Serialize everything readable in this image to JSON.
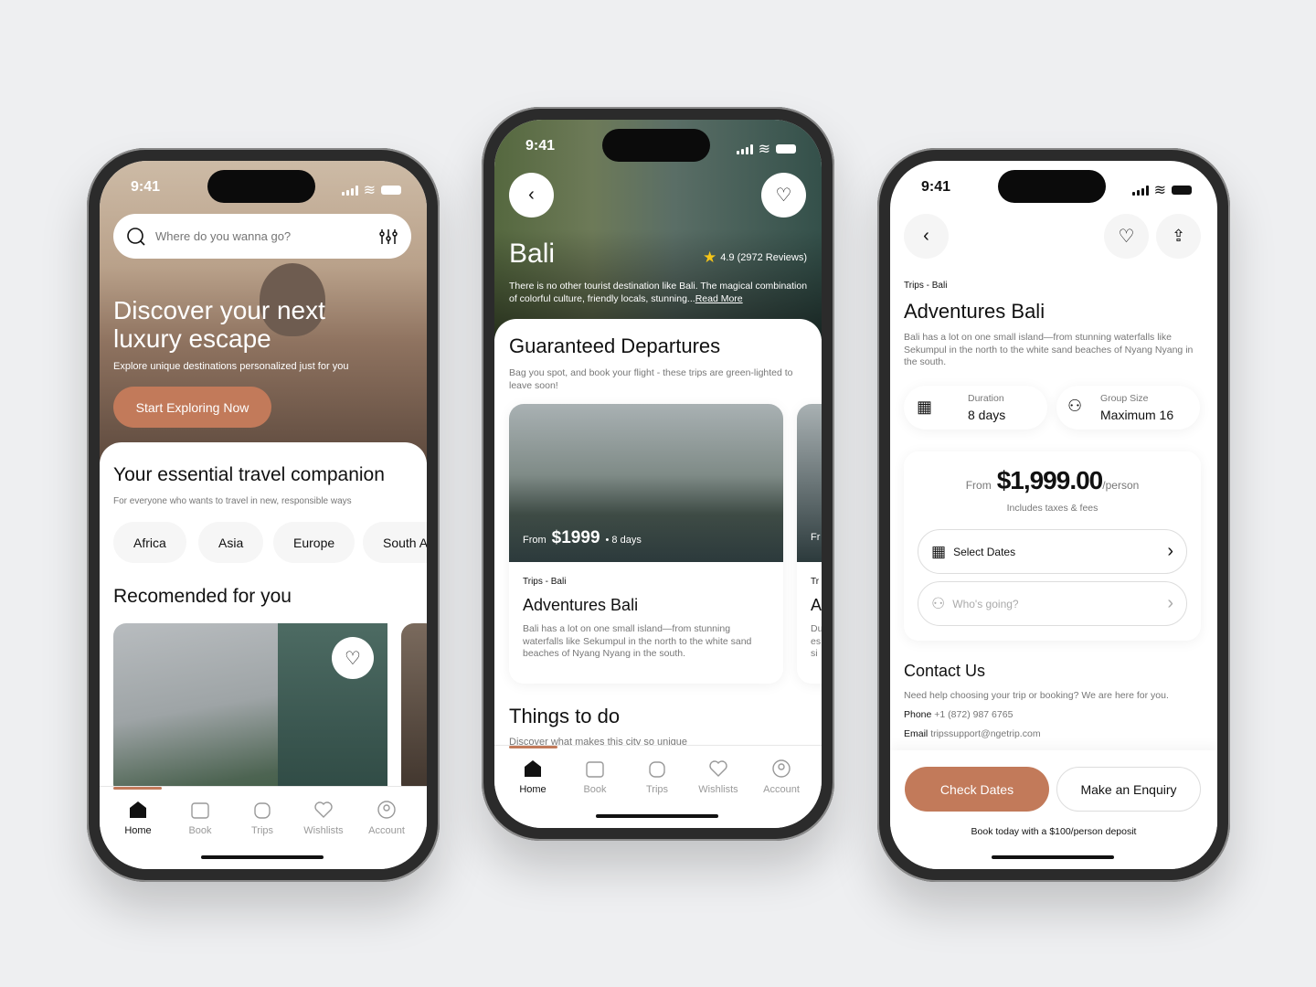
{
  "status_time": "9:41",
  "colors": {
    "accent": "#c27a5a",
    "background": "#eeeff1",
    "star": "#f5c518"
  },
  "tabs": [
    {
      "label": "Home",
      "icon": "home-icon"
    },
    {
      "label": "Book",
      "icon": "calendar-icon"
    },
    {
      "label": "Trips",
      "icon": "luggage-icon"
    },
    {
      "label": "Wishlists",
      "icon": "heart-icon"
    },
    {
      "label": "Account",
      "icon": "user-circle-icon"
    }
  ],
  "home": {
    "search_placeholder": "Where do you wanna go?",
    "hero_title_1": "Discover your next",
    "hero_title_2": "luxury escape",
    "hero_subtitle": "Explore unique destinations personalized just for you",
    "cta": "Start Exploring Now",
    "section_title": "Your essential travel companion",
    "section_subtitle": "For everyone who wants to travel in new, responsible ways",
    "chips": [
      "Africa",
      "Asia",
      "Europe",
      "South America"
    ],
    "recommended_title": "Recomended for you"
  },
  "destination": {
    "title": "Bali",
    "rating": "4.9 (2972 Reviews)",
    "description": "There is no other tourist destination like Bali. The magical combination of colorful culture, friendly locals, stunning...",
    "read_more": "Read More",
    "section_title": "Guaranteed Departures",
    "section_subtitle": "Bag you spot, and book your flight - these trips are green-lighted to leave soon!",
    "card": {
      "from": "From",
      "price": "$1999",
      "days": "• 8 days",
      "breadcrumb": "Trips - Bali",
      "title": "Adventures Bali",
      "description": "Bali has a lot on one small island—from stunning waterfalls like Sekumpul in the north to the white sand beaches of Nyang Nyang in the south."
    },
    "card2_partial": {
      "from": "Fr",
      "breadcrumb": "Tr",
      "title": "A",
      "description": "Du es si"
    },
    "things_title": "Things to do",
    "things_subtitle": "Discover what makes this city so unique"
  },
  "detail": {
    "breadcrumb": "Trips - Bali",
    "title": "Adventures Bali",
    "description": "Bali has a lot on one small island—from stunning waterfalls like Sekumpul in the north to the white sand beaches of Nyang Nyang in the south.",
    "duration_label": "Duration",
    "duration_value": "8 days",
    "group_label": "Group Size",
    "group_value": "Maximum 16",
    "from": "From",
    "price": "$1,999.00",
    "per": "/person",
    "includes": "Includes taxes & fees",
    "select_dates": "Select Dates",
    "whos_going": "Who's going?",
    "contact_title": "Contact Us",
    "contact_text": "Need help choosing your trip or booking? We are here for you.",
    "phone_label": "Phone",
    "phone": "+1 (872) 987 6765",
    "email_label": "Email",
    "email": "tripssupport@ngetrip.com",
    "check_dates": "Check Dates",
    "enquiry": "Make an Enquiry",
    "deposit": "Book today with a $100/person deposit"
  }
}
